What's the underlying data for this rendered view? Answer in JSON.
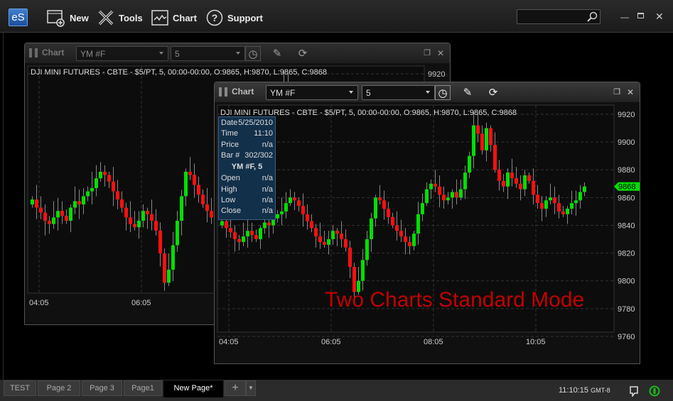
{
  "app": {
    "logo": "eS",
    "toolbar": [
      {
        "label": "New",
        "icon": "new-window-icon"
      },
      {
        "label": "Tools",
        "icon": "tools-icon"
      },
      {
        "label": "Chart",
        "icon": "chart-icon"
      },
      {
        "label": "Support",
        "icon": "help-icon"
      }
    ],
    "search": {
      "value": "",
      "icon": "search-icon"
    }
  },
  "colors": {
    "up": "#00e000",
    "down": "#ff1010",
    "last_price_bg": "#00e000",
    "watermark": "#c40000",
    "tooltip_bg": "#13304a"
  },
  "charts": [
    {
      "title": "Chart",
      "symbol": "YM #F",
      "interval": "5",
      "info": "DJI MINI FUTURES - CBTE - $5/PT, 5, 00:00-00:00, O:9865, H:9870, L:9865, C:9868",
      "price_ticks": [
        "9920"
      ],
      "time_ticks": [
        "04:05",
        "06:05"
      ]
    },
    {
      "title": "Chart",
      "symbol": "YM #F",
      "interval": "5",
      "info": "DJI MINI FUTURES - CBTE - $5/PT, 5, 00:00-00:00, O:9865, H:9870, L:9865, C:9868",
      "price_ticks": [
        "9920",
        "9900",
        "9880",
        "9860",
        "9840",
        "9820",
        "9800",
        "9780",
        "9760"
      ],
      "time_ticks": [
        "04:05",
        "06:05",
        "08:05",
        "10:05"
      ],
      "last_price": "9868",
      "tooltip": {
        "rows": [
          [
            "Date",
            "5/25/2010"
          ],
          [
            "Time",
            "11:10"
          ],
          [
            "Price",
            "n/a"
          ],
          [
            "Bar #",
            "302/302"
          ]
        ],
        "header": "YM #F, 5",
        "ohlc": [
          [
            "Open",
            "n/a"
          ],
          [
            "High",
            "n/a"
          ],
          [
            "Low",
            "n/a"
          ],
          [
            "Close",
            "n/a"
          ]
        ]
      },
      "watermark": "Two Charts Standard Mode"
    }
  ],
  "chart_data": {
    "type": "candlestick",
    "x_start": "04:05",
    "interval_minutes": 5,
    "ylim": [
      9755,
      9925
    ],
    "close": [
      9843,
      9838,
      9835,
      9830,
      9828,
      9832,
      9836,
      9833,
      9830,
      9838,
      9842,
      9840,
      9845,
      9848,
      9850,
      9856,
      9860,
      9858,
      9854,
      9848,
      9843,
      9838,
      9832,
      9828,
      9826,
      9830,
      9836,
      9834,
      9830,
      9824,
      9810,
      9792,
      9800,
      9815,
      9830,
      9845,
      9860,
      9858,
      9852,
      9846,
      9840,
      9836,
      9832,
      9828,
      9825,
      9834,
      9848,
      9856,
      9866,
      9870,
      9868,
      9862,
      9858,
      9860,
      9864,
      9860,
      9866,
      9878,
      9890,
      9912,
      9906,
      9894,
      9910,
      9898,
      9880,
      9872,
      9868,
      9878,
      9874,
      9870,
      9866,
      9876,
      9872,
      9862,
      9856,
      9852,
      9858,
      9860,
      9856,
      9850,
      9848,
      9852,
      9856,
      9858,
      9864,
      9868
    ]
  },
  "tabs": [
    {
      "label": "TEST"
    },
    {
      "label": "Page 2"
    },
    {
      "label": "Page 3"
    },
    {
      "label": "Page1"
    },
    {
      "label": "New Page*",
      "active": true
    }
  ],
  "status": {
    "time": "11:10:15",
    "tz": "GMT-8"
  }
}
